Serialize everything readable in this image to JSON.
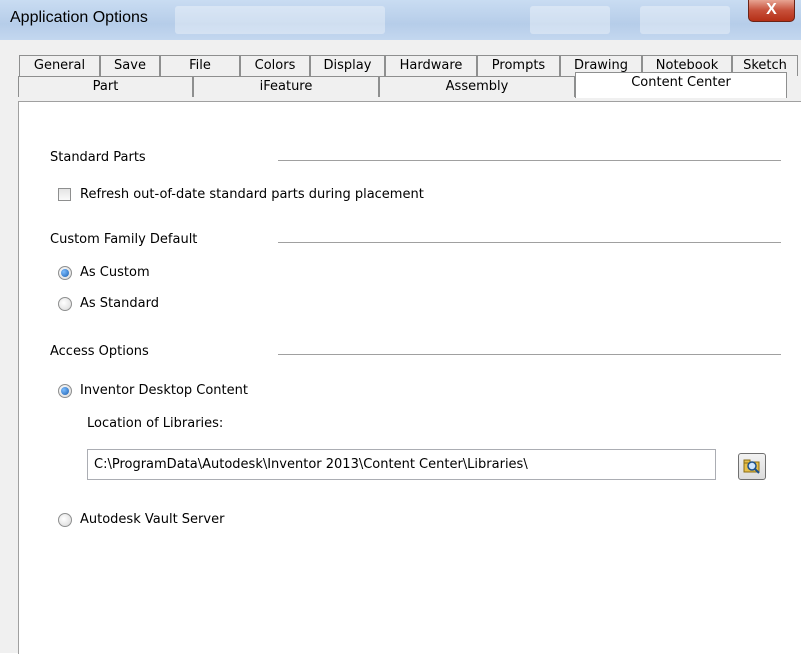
{
  "window": {
    "title": "Application Options",
    "close_label": "X"
  },
  "tabs_row1": [
    {
      "label": "General"
    },
    {
      "label": "Save"
    },
    {
      "label": "File"
    },
    {
      "label": "Colors"
    },
    {
      "label": "Display"
    },
    {
      "label": "Hardware"
    },
    {
      "label": "Prompts"
    },
    {
      "label": "Drawing"
    },
    {
      "label": "Notebook"
    },
    {
      "label": "Sketch"
    }
  ],
  "tabs_row2": [
    {
      "label": "Part"
    },
    {
      "label": "iFeature"
    },
    {
      "label": "Assembly"
    },
    {
      "label": "Content Center",
      "active": true
    }
  ],
  "content": {
    "standard_parts": {
      "heading": "Standard Parts",
      "refresh_label": "Refresh out-of-date standard parts during placement",
      "refresh_checked": false
    },
    "custom_family": {
      "heading": "Custom Family Default",
      "options": [
        {
          "label": "As Custom",
          "selected": true
        },
        {
          "label": "As Standard",
          "selected": false
        }
      ]
    },
    "access": {
      "heading": "Access Options",
      "desktop_label": "Inventor Desktop Content",
      "desktop_selected": true,
      "location_label": "Location of Libraries:",
      "location_value": "C:\\ProgramData\\Autodesk\\Inventor 2013\\Content Center\\Libraries\\",
      "vault_label": "Autodesk Vault Server",
      "vault_selected": false
    }
  },
  "icons": {
    "browse": "folder-search-icon",
    "close": "close-icon"
  },
  "colors": {
    "titlebar": "#c3d7ef",
    "close_button": "#c7503a",
    "dialog_bg": "#f0f0f0",
    "radio_selected": "#1b5fb0"
  }
}
